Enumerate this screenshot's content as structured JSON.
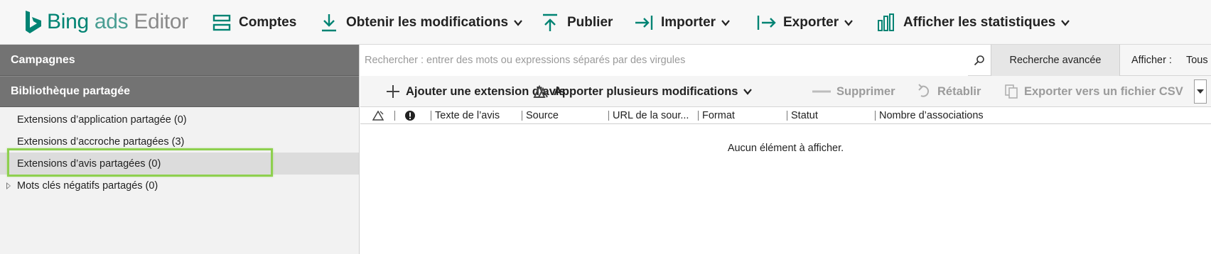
{
  "app": {
    "logo_bing": "Bing",
    "logo_ads": "ads",
    "logo_editor": "Editor"
  },
  "toolbar": {
    "accounts": "Comptes",
    "get_changes": "Obtenir les modifications",
    "publish": "Publier",
    "import": "Importer",
    "export": "Exporter",
    "statistics": "Afficher les statistiques"
  },
  "sidebar": {
    "campaigns_header": "Campagnes",
    "shared_library_header": "Bibliothèque partagée",
    "items": [
      {
        "label": "Extensions d’application partagée (0)"
      },
      {
        "label": "Extensions d’accroche partagées (3)"
      },
      {
        "label": "Extensions d’avis partagées (0)"
      },
      {
        "label": "Mots clés négatifs partagés (0)"
      }
    ]
  },
  "search": {
    "placeholder": "Rechercher : entrer des mots ou expressions séparés par des virgules",
    "advanced_label": "Recherche avancée",
    "show_label": "Afficher :",
    "show_value": "Tous"
  },
  "actions": {
    "add": "Ajouter une extension d’avis",
    "multi_edit": "Apporter plusieurs modifications",
    "delete": "Supprimer",
    "restore": "Rétablir",
    "export_csv": "Exporter vers un fichier CSV"
  },
  "grid": {
    "columns": [
      "Texte de l’avis",
      "Source",
      "URL de la sour...",
      "Format",
      "Statut",
      "Nombre d’associations"
    ],
    "empty_message": "Aucun élément à afficher."
  },
  "colors": {
    "brand": "#008373",
    "header_gray": "#737373",
    "highlight": "#8ed04f"
  }
}
